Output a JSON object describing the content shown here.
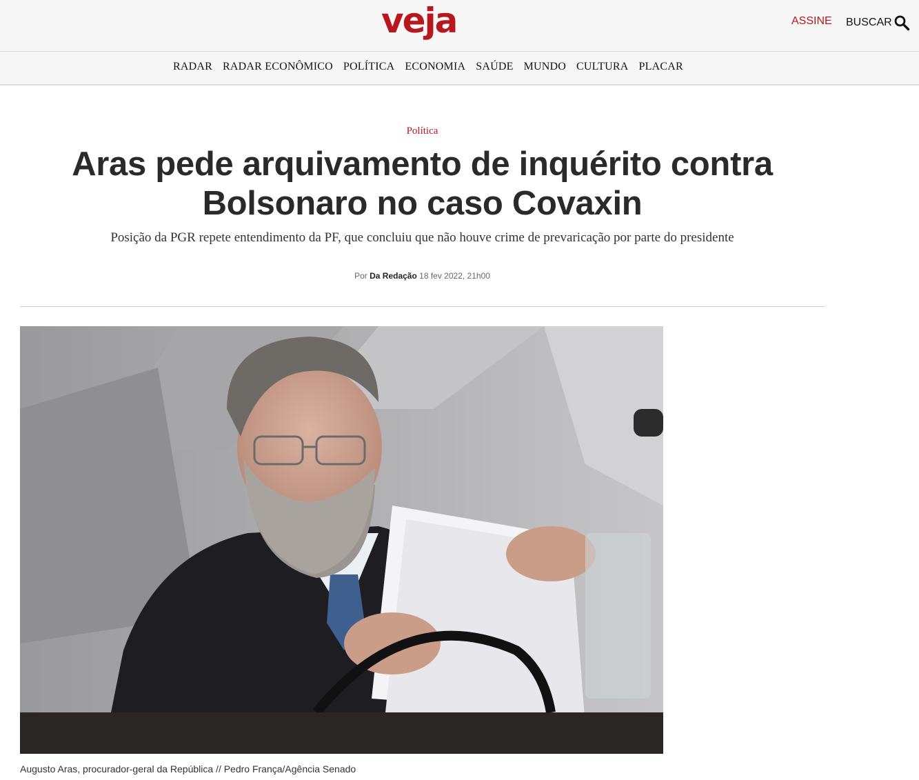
{
  "header": {
    "logo": "veja",
    "subscribe_label": "ASSINE",
    "search_label": "BUSCAR",
    "brand_color": "#b8171d"
  },
  "nav": {
    "items": [
      "RADAR",
      "RADAR ECONÔMICO",
      "POLÍTICA",
      "ECONOMIA",
      "SAÚDE",
      "MUNDO",
      "CULTURA",
      "PLACAR"
    ]
  },
  "article": {
    "section": "Política",
    "headline_line1": "Aras pede arquivamento de inquérito contra",
    "headline_line2": "Bolsonaro no caso Covaxin",
    "subtitle": "Posição da PGR repete entendimento da PF, que concluiu que não houve crime de prevaricação por parte do presidente",
    "byline_prefix": "Por",
    "author": "Da Redação",
    "date": "18 fev 2022, 21h00",
    "photo_caption": "Augusto Aras, procurador-geral da República // Pedro França/Agência Senado"
  },
  "icons": {
    "search": "search-icon"
  }
}
